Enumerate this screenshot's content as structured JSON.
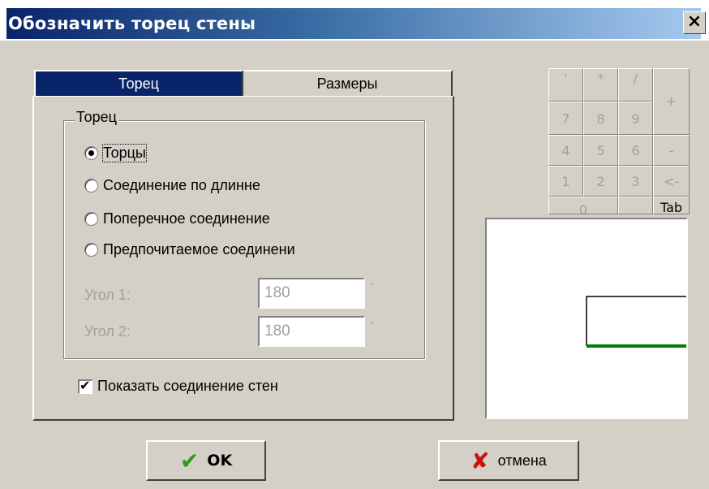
{
  "window": {
    "title": "Обозначить торец стены",
    "close_glyph": "×",
    "close_icon": "close-icon"
  },
  "tabs": [
    {
      "label": "Торец",
      "active": true
    },
    {
      "label": "Размеры",
      "active": false
    }
  ],
  "group": {
    "label": "Торец",
    "options": [
      {
        "label": "Торцы",
        "checked": true
      },
      {
        "label": "Соединение по длинне",
        "checked": false
      },
      {
        "label": "Поперечное соединение",
        "checked": false
      },
      {
        "label": "Предпочитаемое соединени",
        "checked": false
      }
    ],
    "angle1": {
      "label": "Угол 1:",
      "value": "180",
      "unit": "°"
    },
    "angle2": {
      "label": "Угол 2:",
      "value": "180",
      "unit": "°"
    }
  },
  "show_walls": {
    "label": "Показать соединение стен",
    "checked": true
  },
  "keypad": {
    "row1": [
      "'",
      "*",
      "/"
    ],
    "plus": "+",
    "row2": [
      "7",
      "8",
      "9"
    ],
    "row3": [
      "4",
      "5",
      "6"
    ],
    "minus": "-",
    "row4": [
      "1",
      "2",
      "3"
    ],
    "back": "<-",
    "zero": "0",
    "tab": "Tab"
  },
  "buttons": {
    "ok": {
      "label": "OK",
      "icon": "check-icon",
      "icon_color": "#2a9d1a"
    },
    "cancel": {
      "label": "отмена",
      "icon": "cross-icon",
      "icon_color": "#cc1111"
    }
  },
  "preview_line_color": "#008000"
}
